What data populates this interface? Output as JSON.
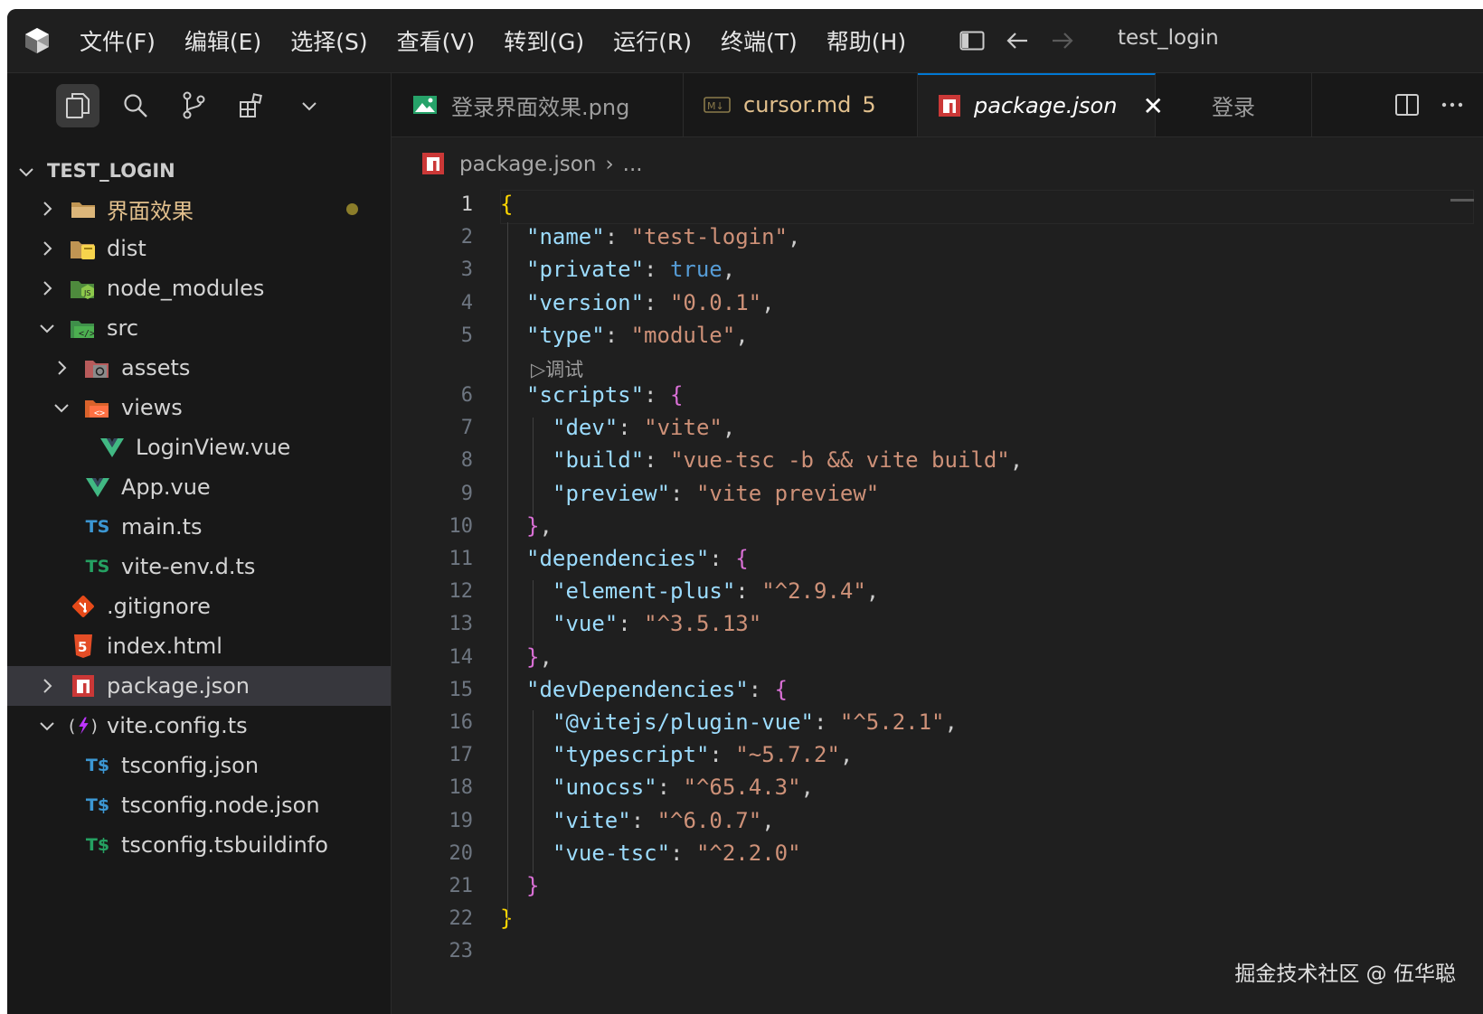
{
  "titlebar": {
    "menu": [
      "文件(F)",
      "编辑(E)",
      "选择(S)",
      "查看(V)",
      "转到(G)",
      "运行(R)",
      "终端(T)",
      "帮助(H)"
    ],
    "title": "test_login"
  },
  "explorer": {
    "header": "TEST_LOGIN",
    "items": [
      {
        "label": "界面效果",
        "modified": true
      },
      {
        "label": "dist"
      },
      {
        "label": "node_modules"
      },
      {
        "label": "src"
      },
      {
        "label": "assets"
      },
      {
        "label": "views"
      },
      {
        "label": "LoginView.vue"
      },
      {
        "label": "App.vue"
      },
      {
        "label": "main.ts"
      },
      {
        "label": "vite-env.d.ts"
      },
      {
        "label": ".gitignore"
      },
      {
        "label": "index.html"
      },
      {
        "label": "package.json",
        "selected": true
      },
      {
        "label": "vite.config.ts"
      },
      {
        "label": "tsconfig.json"
      },
      {
        "label": "tsconfig.node.json"
      },
      {
        "label": "tsconfig.tsbuildinfo"
      }
    ],
    "icon_text": {
      "ts": "TS",
      "tsc": "T$"
    }
  },
  "tabs": [
    {
      "label": "登录界面效果.png"
    },
    {
      "label": "cursor.md",
      "count": "5"
    },
    {
      "label": "package.json",
      "active": true,
      "close": "✕"
    },
    {
      "label": "登录"
    }
  ],
  "breadcrumb": {
    "file": "package.json",
    "rest": "..."
  },
  "editor": {
    "line_numbers": [
      "1",
      "2",
      "3",
      "4",
      "5",
      "6",
      "7",
      "8",
      "9",
      "10",
      "11",
      "12",
      "13",
      "14",
      "15",
      "16",
      "17",
      "18",
      "19",
      "20",
      "21",
      "22",
      "23"
    ],
    "codelens": "▷调试",
    "lines": [
      {
        "t": [
          {
            "c": "br1",
            "v": "{"
          }
        ]
      },
      {
        "t": [
          {
            "c": "k",
            "v": "\"name\""
          },
          {
            "c": "p",
            "v": ": "
          },
          {
            "c": "s",
            "v": "\"test-login\""
          },
          {
            "c": "p",
            "v": ","
          }
        ]
      },
      {
        "t": [
          {
            "c": "k",
            "v": "\"private\""
          },
          {
            "c": "p",
            "v": ": "
          },
          {
            "c": "b",
            "v": "true"
          },
          {
            "c": "p",
            "v": ","
          }
        ]
      },
      {
        "t": [
          {
            "c": "k",
            "v": "\"version\""
          },
          {
            "c": "p",
            "v": ": "
          },
          {
            "c": "s",
            "v": "\"0.0.1\""
          },
          {
            "c": "p",
            "v": ","
          }
        ]
      },
      {
        "t": [
          {
            "c": "k",
            "v": "\"type\""
          },
          {
            "c": "p",
            "v": ": "
          },
          {
            "c": "s",
            "v": "\"module\""
          },
          {
            "c": "p",
            "v": ","
          }
        ]
      },
      {
        "t": [
          {
            "c": "k",
            "v": "\"scripts\""
          },
          {
            "c": "p",
            "v": ": "
          },
          {
            "c": "br2",
            "v": "{"
          }
        ]
      },
      {
        "t": [
          {
            "c": "k",
            "v": "\"dev\""
          },
          {
            "c": "p",
            "v": ": "
          },
          {
            "c": "s",
            "v": "\"vite\""
          },
          {
            "c": "p",
            "v": ","
          }
        ]
      },
      {
        "t": [
          {
            "c": "k",
            "v": "\"build\""
          },
          {
            "c": "p",
            "v": ": "
          },
          {
            "c": "s",
            "v": "\"vue-tsc -b && vite build\""
          },
          {
            "c": "p",
            "v": ","
          }
        ]
      },
      {
        "t": [
          {
            "c": "k",
            "v": "\"preview\""
          },
          {
            "c": "p",
            "v": ": "
          },
          {
            "c": "s",
            "v": "\"vite preview\""
          }
        ]
      },
      {
        "t": [
          {
            "c": "br2",
            "v": "}"
          },
          {
            "c": "p",
            "v": ","
          }
        ]
      },
      {
        "t": [
          {
            "c": "k",
            "v": "\"dependencies\""
          },
          {
            "c": "p",
            "v": ": "
          },
          {
            "c": "br2",
            "v": "{"
          }
        ]
      },
      {
        "t": [
          {
            "c": "k",
            "v": "\"element-plus\""
          },
          {
            "c": "p",
            "v": ": "
          },
          {
            "c": "s",
            "v": "\"^2.9.4\""
          },
          {
            "c": "p",
            "v": ","
          }
        ]
      },
      {
        "t": [
          {
            "c": "k",
            "v": "\"vue\""
          },
          {
            "c": "p",
            "v": ": "
          },
          {
            "c": "s",
            "v": "\"^3.5.13\""
          }
        ]
      },
      {
        "t": [
          {
            "c": "br2",
            "v": "}"
          },
          {
            "c": "p",
            "v": ","
          }
        ]
      },
      {
        "t": [
          {
            "c": "k",
            "v": "\"devDependencies\""
          },
          {
            "c": "p",
            "v": ": "
          },
          {
            "c": "br2",
            "v": "{"
          }
        ]
      },
      {
        "t": [
          {
            "c": "k",
            "v": "\"@vitejs/plugin-vue\""
          },
          {
            "c": "p",
            "v": ": "
          },
          {
            "c": "s",
            "v": "\"^5.2.1\""
          },
          {
            "c": "p",
            "v": ","
          }
        ]
      },
      {
        "t": [
          {
            "c": "k",
            "v": "\"typescript\""
          },
          {
            "c": "p",
            "v": ": "
          },
          {
            "c": "s",
            "v": "\"~5.7.2\""
          },
          {
            "c": "p",
            "v": ","
          }
        ]
      },
      {
        "t": [
          {
            "c": "k",
            "v": "\"unocss\""
          },
          {
            "c": "p",
            "v": ": "
          },
          {
            "c": "s",
            "v": "\"^65.4.3\""
          },
          {
            "c": "p",
            "v": ","
          }
        ]
      },
      {
        "t": [
          {
            "c": "k",
            "v": "\"vite\""
          },
          {
            "c": "p",
            "v": ": "
          },
          {
            "c": "s",
            "v": "\"^6.0.7\""
          },
          {
            "c": "p",
            "v": ","
          }
        ]
      },
      {
        "t": [
          {
            "c": "k",
            "v": "\"vue-tsc\""
          },
          {
            "c": "p",
            "v": ": "
          },
          {
            "c": "s",
            "v": "\"^2.2.0\""
          }
        ]
      },
      {
        "t": [
          {
            "c": "br2",
            "v": "}"
          }
        ]
      },
      {
        "t": [
          {
            "c": "br1",
            "v": "}"
          }
        ]
      },
      {
        "t": []
      }
    ]
  },
  "watermark": "掘金技术社区 @ 伍华聪"
}
